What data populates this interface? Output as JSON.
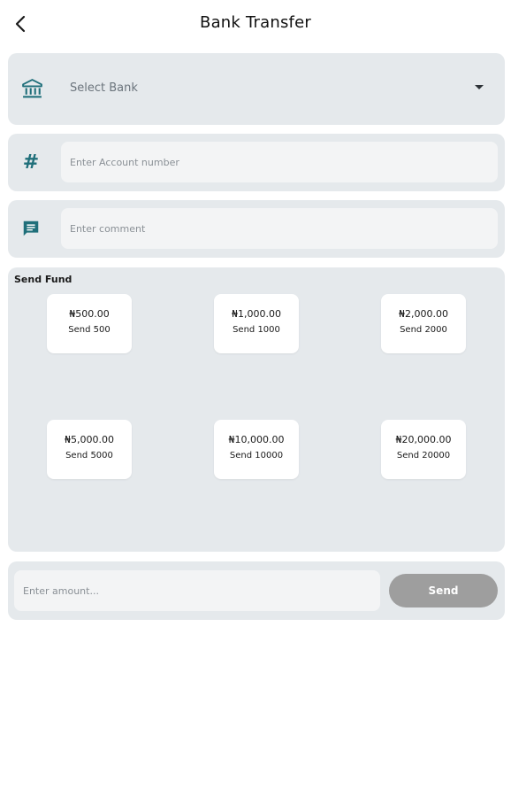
{
  "header": {
    "title": "Bank Transfer",
    "back_icon": "chevron-left-icon"
  },
  "bank": {
    "label": "Select Bank",
    "icon": "bank-icon",
    "dropdown_icon": "caret-down-icon"
  },
  "account": {
    "placeholder": "Enter Account number",
    "icon": "hash-icon"
  },
  "comment": {
    "placeholder": "Enter comment",
    "icon": "comment-icon"
  },
  "fund": {
    "title": "Send Fund",
    "tiles": [
      {
        "amount": "₦500.00",
        "label": "Send 500"
      },
      {
        "amount": "₦1,000.00",
        "label": "Send 1000"
      },
      {
        "amount": "₦2,000.00",
        "label": "Send 2000"
      },
      {
        "amount": "₦5,000.00",
        "label": "Send 5000"
      },
      {
        "amount": "₦10,000.00",
        "label": "Send 10000"
      },
      {
        "amount": "₦20,000.00",
        "label": "Send 20000"
      }
    ]
  },
  "amount": {
    "placeholder": "Enter amount...",
    "send_label": "Send"
  },
  "colors": {
    "accent": "#1f6f7a",
    "card_bg": "#e5e9ec",
    "send_button": "#9e9e9e"
  }
}
